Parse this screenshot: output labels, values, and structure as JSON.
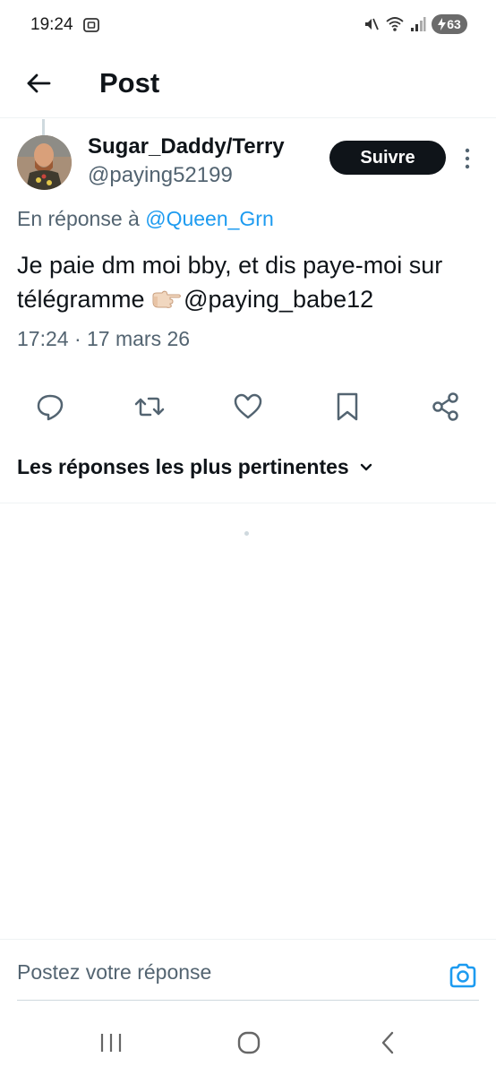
{
  "status_bar": {
    "time": "19:24",
    "battery_level": "63",
    "icons": [
      "screenshot-icon",
      "mute-icon",
      "wifi-icon",
      "signal-icon",
      "battery-charging-icon"
    ]
  },
  "header": {
    "title": "Post"
  },
  "post": {
    "display_name": "Sugar_Daddy/Terry",
    "handle": "@paying52199",
    "follow_label": "Suivre",
    "reply_prefix": "En réponse à ",
    "reply_mention": "@Queen_Grn",
    "body_text": "Je paie dm moi bby, et dis paye-moi sur télégramme ",
    "body_emoji": "pointing-right-emoji",
    "body_mention": "@paying_babe12",
    "timestamp": "17:24 · 17 mars 26"
  },
  "actions": [
    "reply-icon",
    "repost-icon",
    "like-icon",
    "bookmark-icon",
    "share-icon"
  ],
  "replies": {
    "sort_label": "Les réponses les plus pertinentes"
  },
  "composer": {
    "placeholder": "Postez votre réponse"
  },
  "colors": {
    "accent": "#1d9bf0",
    "text": "#0f1419",
    "secondary": "#536471",
    "follow_bg": "#0f1419"
  }
}
